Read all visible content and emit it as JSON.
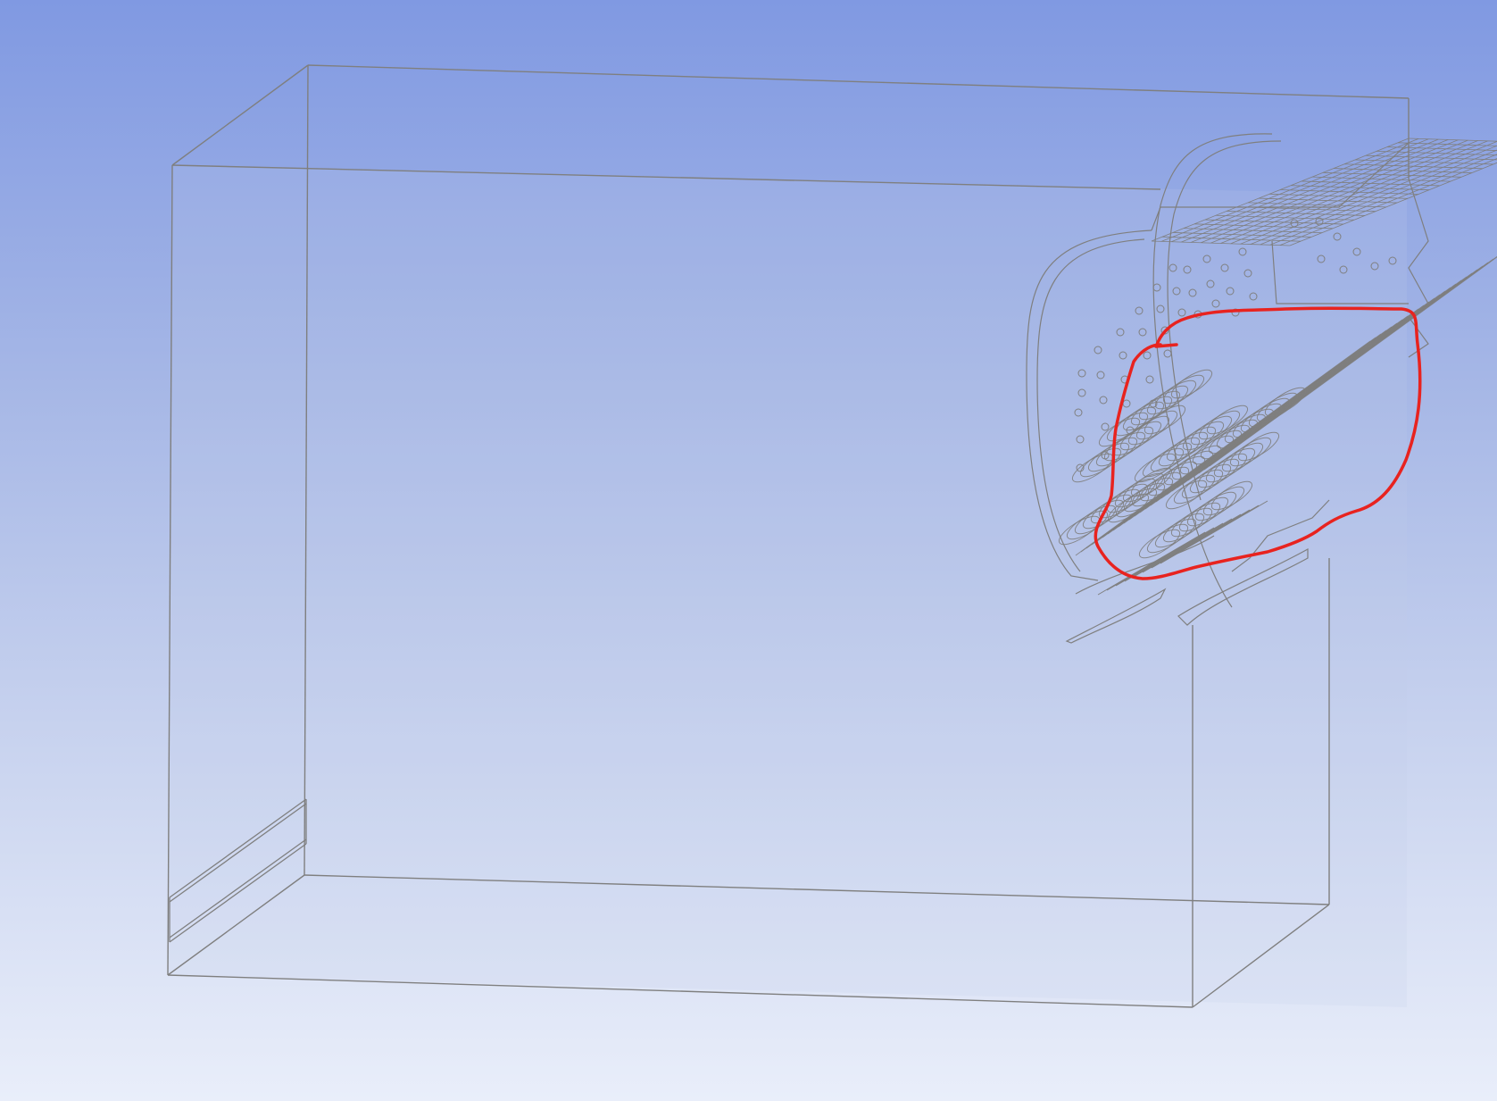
{
  "viewport": {
    "background_top": "#8099e2",
    "background_bottom": "#e9eefa"
  },
  "model": {
    "edge_color": "#7f7f7f",
    "face_fill": "#c4ccea"
  },
  "annotation": {
    "shape": "freehand-loop",
    "color": "#e8231f"
  },
  "icons": {
    "highlight": "highlight-annotation-icon"
  }
}
